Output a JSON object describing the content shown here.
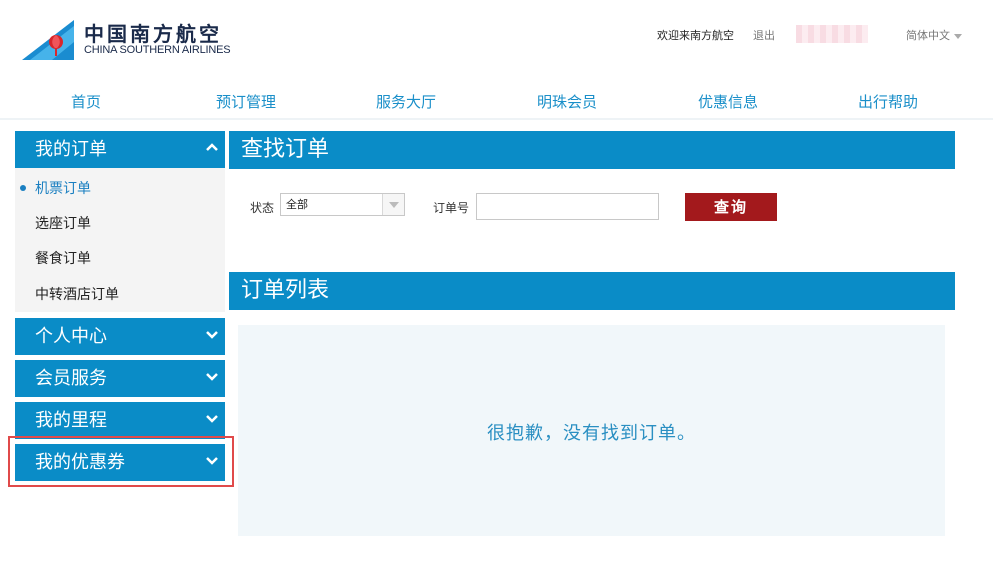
{
  "header": {
    "logo_cn": "中国南方航空",
    "logo_en": "CHINA SOUTHERN AIRLINES",
    "welcome": "欢迎来南方航空",
    "logout": "退出",
    "language": "简体中文"
  },
  "nav": [
    "首页",
    "预订管理",
    "服务大厅",
    "明珠会员",
    "优惠信息",
    "出行帮助"
  ],
  "sidebar": {
    "my_orders": {
      "label": "我的订单",
      "items": [
        "机票订单",
        "选座订单",
        "餐食订单",
        "中转酒店订单"
      ],
      "active_index": 0
    },
    "personal_center": "个人中心",
    "member_service": "会员服务",
    "my_miles": "我的里程",
    "my_coupons": "我的优惠券"
  },
  "search": {
    "title": "查找订单",
    "status_label": "状态",
    "status_value": "全部",
    "order_no_label": "订单号",
    "order_no_value": "",
    "query_button": "查询"
  },
  "list": {
    "title": "订单列表",
    "empty_message": "很抱歉，没有找到订单。"
  },
  "colors": {
    "primary_blue": "#0a8cc7",
    "button_red": "#a3191c",
    "highlight_red": "#e04a4a",
    "panel_bg": "#f1f7fa"
  }
}
